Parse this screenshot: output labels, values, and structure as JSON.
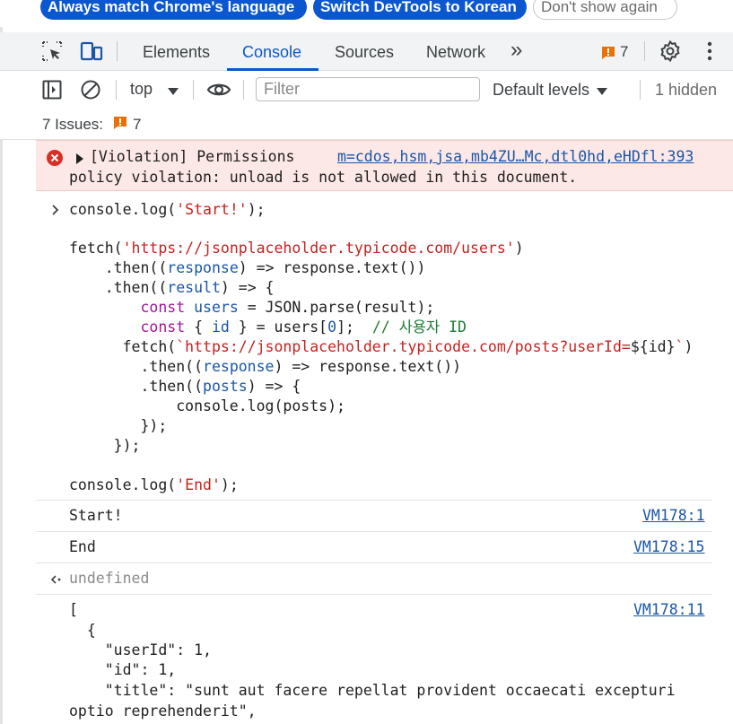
{
  "infobar": {
    "match_language": "Always match Chrome's language",
    "switch_language": "Switch DevTools to Korean",
    "dont_show": "Don't show again"
  },
  "tabs": {
    "elements": "Elements",
    "console": "Console",
    "sources": "Sources",
    "network": "Network",
    "more": "»",
    "issues_count": "7"
  },
  "toolbar": {
    "context": "top",
    "filter_placeholder": "Filter",
    "filter_value": "",
    "levels": "Default levels",
    "hidden": "1 hidden"
  },
  "issues": {
    "label": "7 Issues:",
    "count": "7"
  },
  "violation": {
    "line1": "[Violation] Permissions",
    "source": "m=cdos,hsm,jsa,mb4ZU…Mc,dtl0hd,eHDfl:393",
    "line2": "policy violation: unload is not allowed in this document."
  },
  "outputs": {
    "start": "Start!",
    "start_src": "VM178:1",
    "end": "End",
    "end_src": "VM178:15",
    "undefined": "undefined",
    "json_src": "VM178:11",
    "json_lines": [
      "[",
      "  {",
      "    \"userId\": 1,",
      "    \"id\": 1,",
      "    \"title\": \"sunt aut facere repellat provident occaecati excepturi",
      "optio reprehenderit\","
    ]
  },
  "colors": {
    "accent": "#0b57d0",
    "error": "#d93025",
    "violation_bg": "#fce8e6",
    "issue_orange": "#e8710a"
  },
  "icons": [
    "inspect-icon",
    "device-toolbar-icon",
    "issue-flag-icon",
    "settings-gear-icon",
    "more-vert-icon",
    "sidebar-toggle-icon",
    "clear-console-icon",
    "dropdown-arrow-icon",
    "eye-icon",
    "error-circle-icon",
    "expand-triangle-icon",
    "prompt-chevron-icon",
    "return-arrow-icon"
  ]
}
